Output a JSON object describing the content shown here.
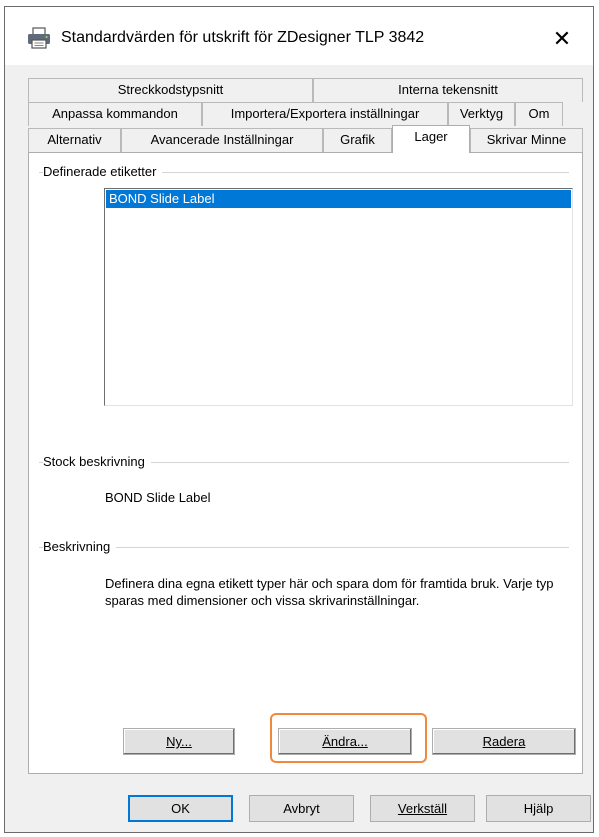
{
  "window": {
    "title": "Standardvärden för utskrift för ZDesigner TLP 3842",
    "close_glyph": "✕"
  },
  "tabs": {
    "row1": [
      "Streckkodstypsnitt",
      "Interna tekensnitt"
    ],
    "row2": [
      "Anpassa kommandon",
      "Importera/Exportera inställningar",
      "Verktyg",
      "Om"
    ],
    "row3": [
      "Alternativ",
      "Avancerade Inställningar",
      "Grafik",
      "Lager",
      "Skrivar Minne"
    ],
    "selected": "Lager"
  },
  "defined_labels": {
    "group_label": "Definerade etiketter",
    "items": [
      "BOND Slide Label"
    ],
    "selected_item": "BOND Slide Label"
  },
  "stock": {
    "group_label": "Stock beskrivning",
    "value": "BOND Slide Label"
  },
  "description": {
    "group_label": "Beskrivning",
    "text": "Definera dina egna etikett typer här och spara dom för framtida bruk. Varje typ sparas med dimensioner och vissa skrivarinställningar."
  },
  "panel_buttons": {
    "new": "Ny...",
    "edit": "Ändra...",
    "delete": "Radera"
  },
  "dialog_buttons": {
    "ok": "OK",
    "cancel": "Avbryt",
    "apply": "Verkställ",
    "help": "Hjälp"
  },
  "colors": {
    "selection": "#0078d7",
    "highlight_box": "#f0883e"
  }
}
